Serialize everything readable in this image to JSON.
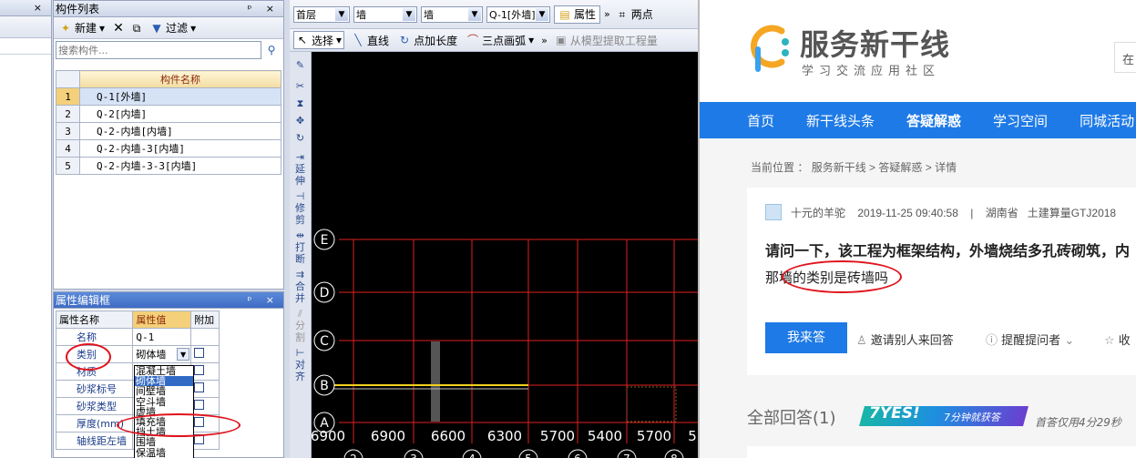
{
  "gtj": {
    "left_panel": {
      "close_label": "×"
    },
    "component_list": {
      "title": "构件列表",
      "new_label": "新建",
      "filter_label": "过滤",
      "search_placeholder": "搜索构件...",
      "column_header": "构件名称",
      "rows": [
        {
          "num": "1",
          "name": "Q-1[外墙]"
        },
        {
          "num": "2",
          "name": "Q-2[内墙]"
        },
        {
          "num": "3",
          "name": "Q-2-内墙[内墙]"
        },
        {
          "num": "4",
          "name": "Q-2-内墙-3[内墙]"
        },
        {
          "num": "5",
          "name": "Q-2-内墙-3-3[内墙]"
        }
      ]
    },
    "property_panel": {
      "title": "属性编辑框",
      "headers": [
        "属性名称",
        "属性值",
        "附加"
      ],
      "rows": [
        {
          "name": "名称",
          "value": "Q-1"
        },
        {
          "name": "类别",
          "value": "砌体墙"
        },
        {
          "name": "材质",
          "value": ""
        },
        {
          "name": "砂浆标号",
          "value": ""
        },
        {
          "name": "砂浆类型",
          "value": ""
        },
        {
          "name": "厚度(mm)",
          "value": ""
        },
        {
          "name": "轴线距左墙",
          "value": ""
        }
      ],
      "dropdown_options": [
        "混凝土墙",
        "砌体墙",
        "间壁墙",
        "空斗墙",
        "虚墙",
        "填充墙",
        "挡土墙",
        "围墙",
        "保温墙"
      ]
    },
    "top_toolbar": {
      "floor": "首层",
      "type1": "墙",
      "type2": "墙",
      "component": "Q-1[外墙]",
      "properties_label": "属性",
      "two_points_label": "两点"
    },
    "draw_toolbar": {
      "select_label": "选择",
      "line_label": "直线",
      "point_length_label": "点加长度",
      "arc_label": "三点画弧",
      "extract_label": "从模型提取工程量"
    },
    "side_tools": [
      "延伸",
      "修剪",
      "打断",
      "合并",
      "分割",
      "对齐"
    ],
    "axis_rows": [
      "E",
      "D",
      "C",
      "B",
      "A"
    ],
    "dimensions": [
      "6900",
      "6900",
      "6600",
      "6300",
      "5700",
      "5400",
      "5700",
      "5"
    ],
    "axis_cols": [
      "2",
      "3",
      "4",
      "5",
      "6",
      "7",
      "8"
    ]
  },
  "web": {
    "logo_title": "服务新干线",
    "logo_subtitle": "学习交流应用社区",
    "search_stub": "在",
    "nav": [
      "首页",
      "新干线头条",
      "答疑解惑",
      "学习空间",
      "同城活动"
    ],
    "active_nav": "答疑解惑",
    "breadcrumb": {
      "prefix": "当前位置 ：",
      "items": [
        "服务新干线",
        "答疑解惑",
        "详情"
      ]
    },
    "question": {
      "author": "十元的羊驼",
      "date": "2019-11-25 09:40:58",
      "location": "湖南省",
      "tag": "土建算量GTJ2018",
      "title": "请问一下，该工程为框架结构，外墙烧结多孔砖砌筑，内",
      "subtitle": "那墙的类别是砖墙吗",
      "answer_button": "我来答",
      "invite_label": "邀请别人来回答",
      "remind_label": "提醒提问者",
      "collect_label": "收"
    },
    "answers": {
      "label": "全部回答(1)",
      "badge_text": "7YES!",
      "badge_sub": "7分钟就获答",
      "first_answer_note": "首答仅用4分29秒"
    },
    "colors": {
      "nav_blue": "#1e7ae6",
      "button_blue": "#1e7ae6",
      "annotation_red": "#e0141e"
    }
  }
}
